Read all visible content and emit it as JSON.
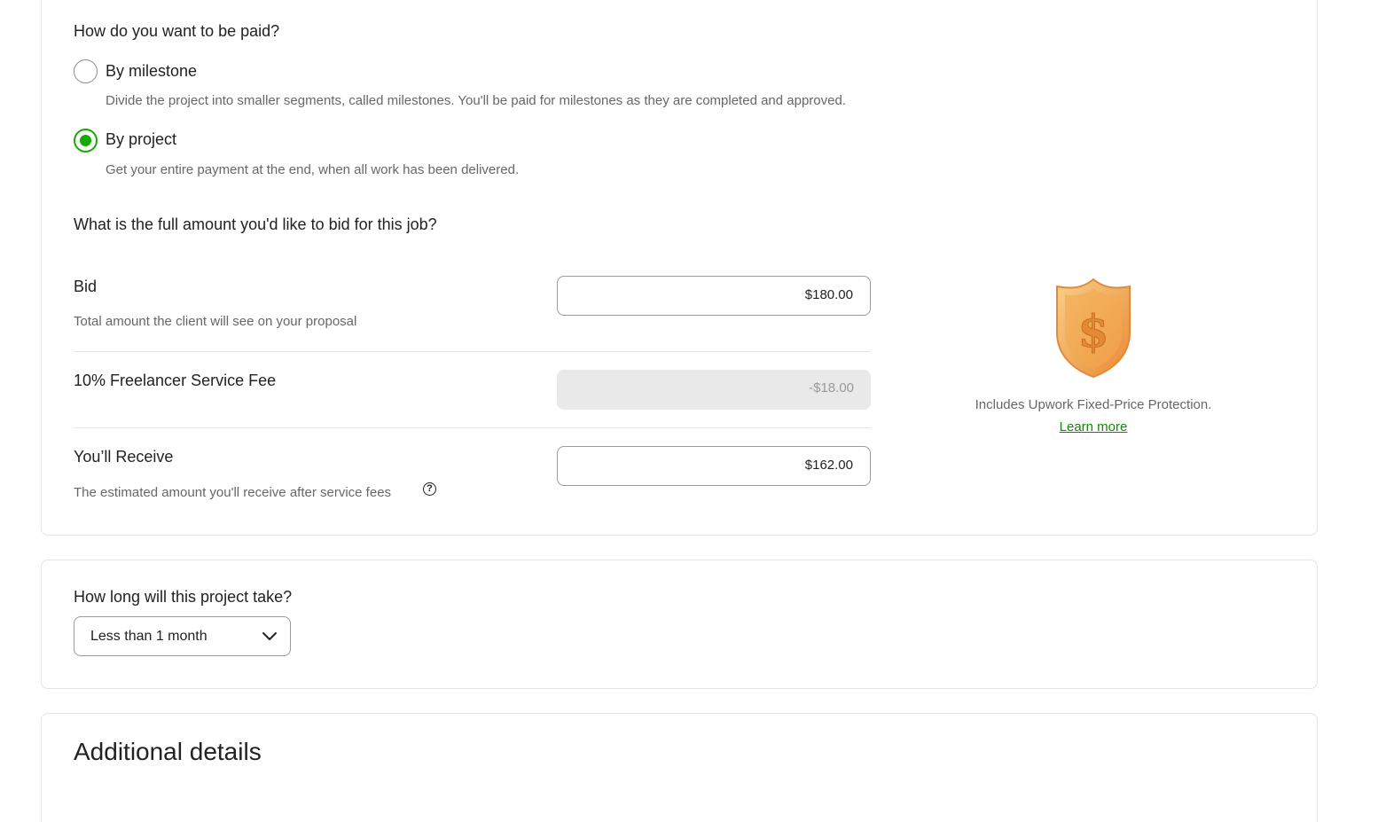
{
  "payment": {
    "question": "How do you want to be paid?",
    "options": [
      {
        "label": "By milestone",
        "description": "Divide the project into smaller segments, called milestones. You'll be paid for milestones as they are completed and approved.",
        "selected": false
      },
      {
        "label": "By project",
        "description": "Get your entire payment at the end, when all work has been delivered.",
        "selected": true
      }
    ]
  },
  "bid": {
    "question": "What is the full amount you'd like to bid for this job?",
    "bid_title": "Bid",
    "bid_subtitle": "Total amount the client will see on your proposal",
    "bid_value": "$180.00",
    "fee_title": "10% Freelancer Service Fee",
    "fee_value": "-$18.00",
    "receive_title": "You’ll Receive",
    "receive_subtitle": "The estimated amount you'll receive after service fees",
    "receive_value": "$162.00",
    "help_icon_glyph": "?"
  },
  "protection": {
    "icon": "shield-dollar-icon",
    "text": "Includes Upwork Fixed-Price Protection.",
    "link": "Learn more",
    "colors": {
      "shield_light": "#f6c27a",
      "shield_dark": "#e8923a",
      "link": "#108a00"
    }
  },
  "duration": {
    "question": "How long will this project take?",
    "selected": "Less than 1 month"
  },
  "details": {
    "title": "Additional details"
  },
  "theme": {
    "accent": "#14a800",
    "border": "#e4e4e4"
  }
}
